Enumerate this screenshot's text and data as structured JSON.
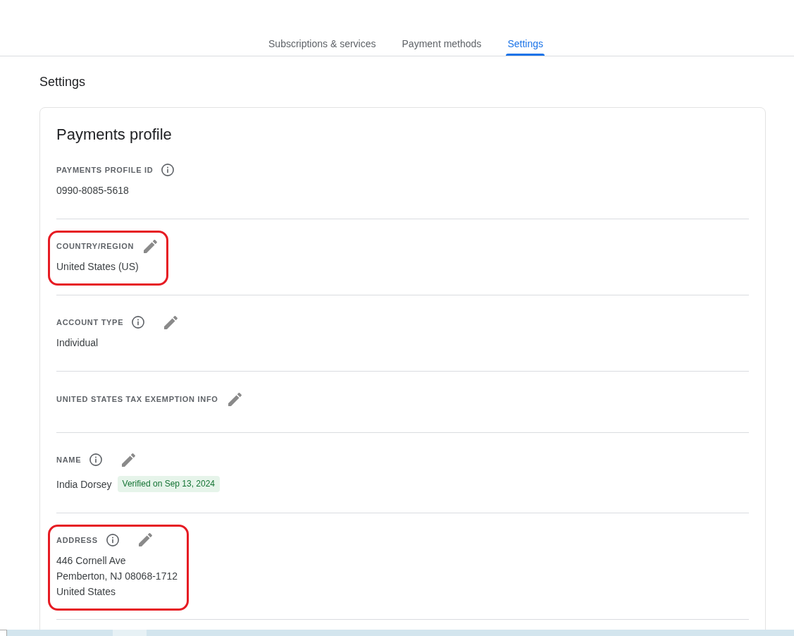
{
  "tabs": [
    {
      "label": "Subscriptions & services",
      "selected": false
    },
    {
      "label": "Payment methods",
      "selected": false
    },
    {
      "label": "Settings",
      "selected": true
    }
  ],
  "page_title": "Settings",
  "card": {
    "title": "Payments profile",
    "sections": [
      {
        "label": "PAYMENTS PROFILE ID",
        "info": true,
        "editable": false,
        "highlighted": false,
        "lines": [
          "0990-8085-5618"
        ]
      },
      {
        "label": "COUNTRY/REGION",
        "info": false,
        "editable": true,
        "highlighted": true,
        "lines": [
          "United States (US)"
        ]
      },
      {
        "label": "ACCOUNT TYPE",
        "info": true,
        "editable": true,
        "highlighted": false,
        "lines": [
          "Individual"
        ]
      },
      {
        "label": "UNITED STATES TAX EXEMPTION INFO",
        "info": false,
        "editable": true,
        "highlighted": false
      },
      {
        "label": "NAME",
        "info": true,
        "editable": true,
        "highlighted": false,
        "lines": [
          "India Dorsey"
        ],
        "badge": "Verified on Sep 13, 2024"
      },
      {
        "label": "ADDRESS",
        "info": true,
        "editable": true,
        "highlighted": true,
        "lines": [
          "446 Cornell Ave",
          "Pemberton, NJ 08068-1712",
          "United States"
        ]
      }
    ]
  }
}
